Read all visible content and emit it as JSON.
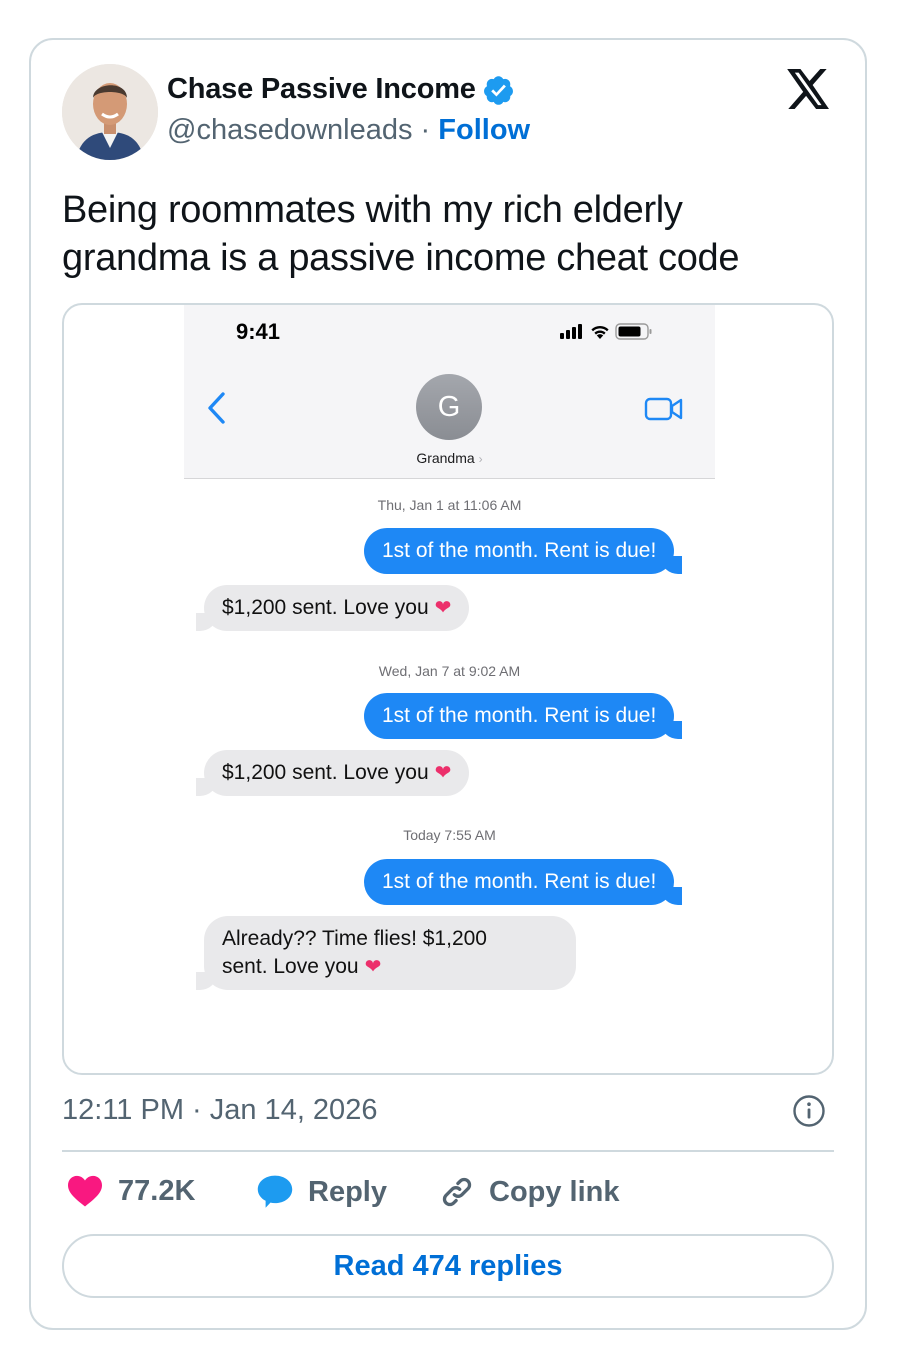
{
  "author": {
    "name": "Chase Passive Income",
    "handle": "@chasedownleads",
    "separator": "·",
    "follow_label": "Follow"
  },
  "tweet": {
    "text": "Being roommates with my rich elderly grandma is a passive income cheat code",
    "timestamp": "12:11 PM · Jan 14, 2026"
  },
  "screenshot": {
    "status_time": "9:41",
    "contact_initial": "G",
    "contact_name": "Grandma",
    "conversation": [
      {
        "timestamp": "Thu, Jan 1 at 11:06 AM",
        "sent": "1st of the month. Rent is due!",
        "received": "$1,200 sent. Love you",
        "received_emoji": "❤"
      },
      {
        "timestamp": "Wed, Jan 7 at 9:02 AM",
        "sent": "1st of the month. Rent is due!",
        "received": "$1,200 sent. Love you",
        "received_emoji": "❤"
      },
      {
        "timestamp": "Today 7:55 AM",
        "sent": "1st of the month. Rent is due!",
        "received_line1": "Already?? Time flies! $1,200",
        "received_line2": "sent. Love you",
        "received_emoji": "❤"
      }
    ]
  },
  "actions": {
    "like_count": "77.2K",
    "reply_label": "Reply",
    "copy_label": "Copy link",
    "read_replies_label": "Read 474 replies"
  },
  "colors": {
    "accent": "#006fd6",
    "verified": "#1d9bf0",
    "imessage_blue": "#1e88f5",
    "heart": "#f91880"
  }
}
